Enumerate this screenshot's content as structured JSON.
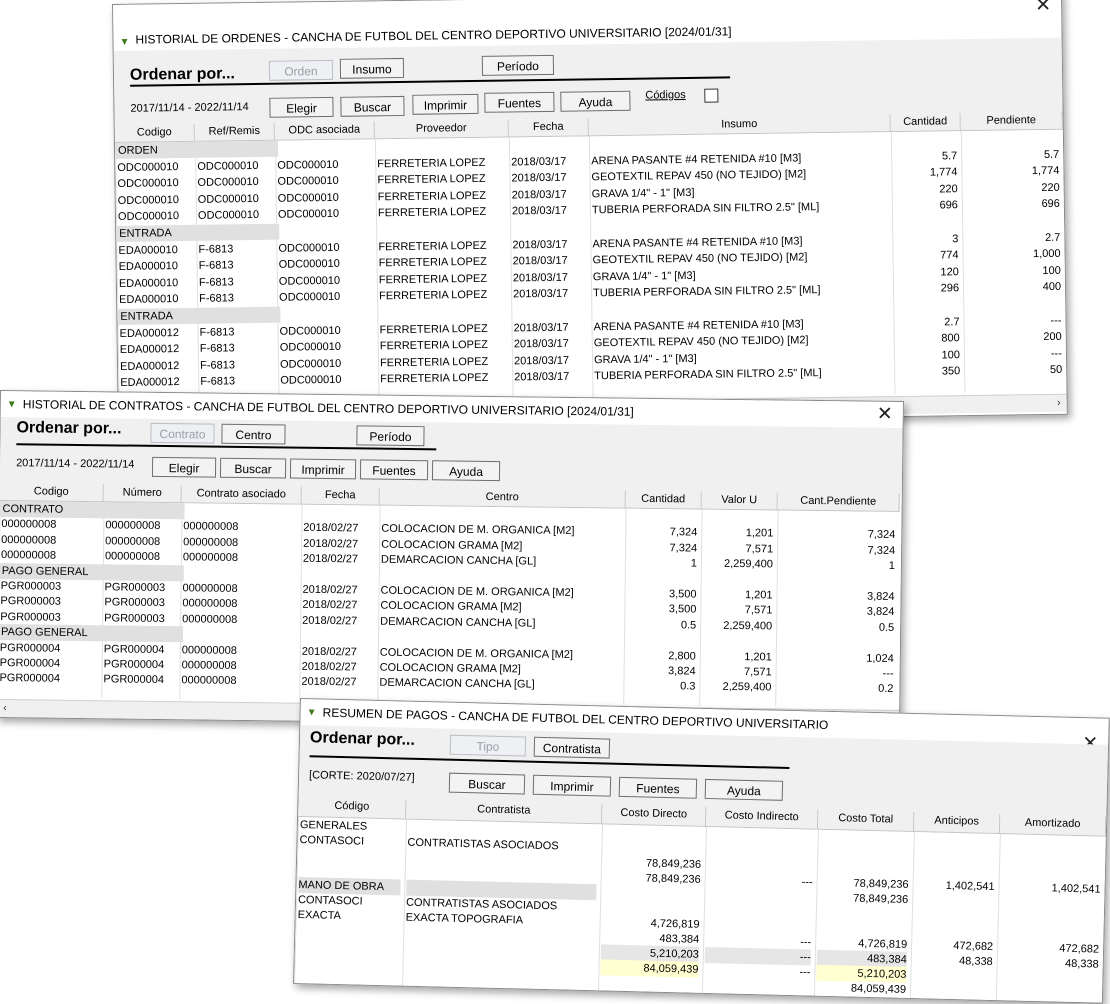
{
  "w1": {
    "title": "HISTORIAL DE ORDENES - CANCHA DE FUTBOL DEL CENTRO DEPORTIVO UNIVERSITARIO [2024/01/31]",
    "sort_label": "Ordenar por...",
    "sort_buttons": [
      "Orden",
      "Insumo",
      "Período"
    ],
    "date_range": "2017/11/14 - 2022/11/14",
    "action_buttons": [
      "Elegir",
      "Buscar",
      "Imprimir",
      "Fuentes",
      "Ayuda"
    ],
    "codes_label": "Códigos",
    "columns": [
      "Codigo",
      "Ref/Remis",
      "ODC asociada",
      "Proveedor",
      "Fecha",
      "Insumo",
      "Cantidad",
      "Pendiente"
    ],
    "groups": [
      {
        "label": "ORDEN",
        "rows": [
          [
            "ODC000010",
            "ODC000010",
            "ODC000010",
            "FERRETERIA LOPEZ",
            "2018/03/17",
            "ARENA PASANTE #4 RETENIDA #10 [M3]",
            "5.7",
            "5.7"
          ],
          [
            "ODC000010",
            "ODC000010",
            "ODC000010",
            "FERRETERIA LOPEZ",
            "2018/03/17",
            "GEOTEXTIL REPAV 450 (NO TEJIDO) [M2]",
            "1,774",
            "1,774"
          ],
          [
            "ODC000010",
            "ODC000010",
            "ODC000010",
            "FERRETERIA LOPEZ",
            "2018/03/17",
            "GRAVA 1/4\" - 1\" [M3]",
            "220",
            "220"
          ],
          [
            "ODC000010",
            "ODC000010",
            "ODC000010",
            "FERRETERIA LOPEZ",
            "2018/03/17",
            "TUBERIA PERFORADA SIN FILTRO 2.5\" [ML]",
            "696",
            "696"
          ]
        ]
      },
      {
        "label": "ENTRADA",
        "rows": [
          [
            "EDA000010",
            "F-6813",
            "ODC000010",
            "FERRETERIA LOPEZ",
            "2018/03/17",
            "ARENA PASANTE #4 RETENIDA #10 [M3]",
            "3",
            "2.7"
          ],
          [
            "EDA000010",
            "F-6813",
            "ODC000010",
            "FERRETERIA LOPEZ",
            "2018/03/17",
            "GEOTEXTIL REPAV 450 (NO TEJIDO) [M2]",
            "774",
            "1,000"
          ],
          [
            "EDA000010",
            "F-6813",
            "ODC000010",
            "FERRETERIA LOPEZ",
            "2018/03/17",
            "GRAVA 1/4\" - 1\" [M3]",
            "120",
            "100"
          ],
          [
            "EDA000010",
            "F-6813",
            "ODC000010",
            "FERRETERIA LOPEZ",
            "2018/03/17",
            "TUBERIA PERFORADA SIN FILTRO 2.5\" [ML]",
            "296",
            "400"
          ]
        ]
      },
      {
        "label": "ENTRADA",
        "rows": [
          [
            "EDA000012",
            "F-6813",
            "ODC000010",
            "FERRETERIA LOPEZ",
            "2018/03/17",
            "ARENA PASANTE #4 RETENIDA #10 [M3]",
            "2.7",
            "---"
          ],
          [
            "EDA000012",
            "F-6813",
            "ODC000010",
            "FERRETERIA LOPEZ",
            "2018/03/17",
            "GEOTEXTIL REPAV 450 (NO TEJIDO) [M2]",
            "800",
            "200"
          ],
          [
            "EDA000012",
            "F-6813",
            "ODC000010",
            "FERRETERIA LOPEZ",
            "2018/03/17",
            "GRAVA 1/4\" - 1\" [M3]",
            "100",
            "---"
          ],
          [
            "EDA000012",
            "F-6813",
            "ODC000010",
            "FERRETERIA LOPEZ",
            "2018/03/17",
            "TUBERIA PERFORADA SIN FILTRO 2.5\" [ML]",
            "350",
            "50"
          ]
        ]
      }
    ]
  },
  "w2": {
    "title": "HISTORIAL DE CONTRATOS - CANCHA DE FUTBOL DEL CENTRO DEPORTIVO UNIVERSITARIO [2024/01/31]",
    "sort_label": "Ordenar por...",
    "sort_buttons": [
      "Contrato",
      "Centro",
      "Período"
    ],
    "date_range": "2017/11/14 - 2022/11/14",
    "action_buttons": [
      "Elegir",
      "Buscar",
      "Imprimir",
      "Fuentes",
      "Ayuda"
    ],
    "columns": [
      "Codigo",
      "Número",
      "Contrato asociado",
      "Fecha",
      "Centro",
      "Cantidad",
      "Valor U",
      "Cant.Pendiente"
    ],
    "groups": [
      {
        "label": "CONTRATO",
        "rows": [
          [
            "000000008",
            "000000008",
            "000000008",
            "2018/02/27",
            "COLOCACION DE M. ORGANICA [M2]",
            "7,324",
            "1,201",
            "7,324"
          ],
          [
            "000000008",
            "000000008",
            "000000008",
            "2018/02/27",
            "COLOCACION GRAMA [M2]",
            "7,324",
            "7,571",
            "7,324"
          ],
          [
            "000000008",
            "000000008",
            "000000008",
            "2018/02/27",
            "DEMARCACION CANCHA [GL]",
            "1",
            "2,259,400",
            "1"
          ]
        ]
      },
      {
        "label": "PAGO GENERAL",
        "rows": [
          [
            "PGR000003",
            "PGR000003",
            "000000008",
            "2018/02/27",
            "COLOCACION DE M. ORGANICA [M2]",
            "3,500",
            "1,201",
            "3,824"
          ],
          [
            "PGR000003",
            "PGR000003",
            "000000008",
            "2018/02/27",
            "COLOCACION GRAMA [M2]",
            "3,500",
            "7,571",
            "3,824"
          ],
          [
            "PGR000003",
            "PGR000003",
            "000000008",
            "2018/02/27",
            "DEMARCACION CANCHA [GL]",
            "0.5",
            "2,259,400",
            "0.5"
          ]
        ]
      },
      {
        "label": "PAGO GENERAL",
        "rows": [
          [
            "PGR000004",
            "PGR000004",
            "000000008",
            "2018/02/27",
            "COLOCACION DE M. ORGANICA [M2]",
            "2,800",
            "1,201",
            "1,024"
          ],
          [
            "PGR000004",
            "PGR000004",
            "000000008",
            "2018/02/27",
            "COLOCACION GRAMA [M2]",
            "3,824",
            "7,571",
            "---"
          ],
          [
            "PGR000004",
            "PGR000004",
            "000000008",
            "2018/02/27",
            "DEMARCACION CANCHA [GL]",
            "0.3",
            "2,259,400",
            "0.2"
          ]
        ]
      }
    ]
  },
  "w3": {
    "title": "RESUMEN DE PAGOS - CANCHA DE FUTBOL DEL CENTRO DEPORTIVO UNIVERSITARIO",
    "sort_label": "Ordenar por...",
    "sort_buttons": [
      "Tipo",
      "Contratista"
    ],
    "cut_label": "[CORTE: 2020/07/27]",
    "action_buttons": [
      "Buscar",
      "Imprimir",
      "Fuentes",
      "Ayuda"
    ],
    "columns": [
      "Código",
      "Contratista",
      "Costo Directo",
      "Costo Indirecto",
      "Costo Total",
      "Anticipos",
      "Amortizado"
    ],
    "rows": [
      {
        "cells": [
          "GENERALES",
          "",
          "",
          "",
          "",
          "",
          ""
        ],
        "style": "plain"
      },
      {
        "cells": [
          "CONTASOCI",
          "CONTRATISTAS ASOCIADOS",
          "",
          "",
          "",
          "",
          ""
        ],
        "style": "plain"
      },
      {
        "cells": [
          "",
          "",
          "78,849,236",
          "",
          "",
          "",
          ""
        ],
        "style": "plain"
      },
      {
        "cells": [
          "",
          "",
          "78,849,236",
          "---",
          "78,849,236",
          "1,402,541",
          "1,402,541"
        ],
        "style": "plain"
      },
      {
        "cells": [
          "MANO DE OBRA",
          "",
          "",
          "",
          "78,849,236",
          "",
          ""
        ],
        "style": "grp"
      },
      {
        "cells": [
          "CONTASOCI",
          "CONTRATISTAS ASOCIADOS",
          "",
          "",
          "",
          "",
          ""
        ],
        "style": "plain"
      },
      {
        "cells": [
          "EXACTA",
          "EXACTA TOPOGRAFIA",
          "4,726,819",
          "",
          "",
          "",
          ""
        ],
        "style": "plain"
      },
      {
        "cells": [
          "",
          "",
          "483,384",
          "---",
          "4,726,819",
          "472,682",
          "472,682"
        ],
        "style": "plain"
      },
      {
        "cells": [
          "",
          "",
          "5,210,203",
          "---",
          "483,384",
          "48,338",
          "48,338"
        ],
        "style": "tot"
      },
      {
        "cells": [
          "",
          "",
          "84,059,439",
          "---",
          "5,210,203",
          "",
          ""
        ],
        "style": "yel"
      },
      {
        "cells": [
          "",
          "",
          "",
          "",
          "84,059,439",
          "",
          ""
        ],
        "style": "plain"
      }
    ]
  }
}
